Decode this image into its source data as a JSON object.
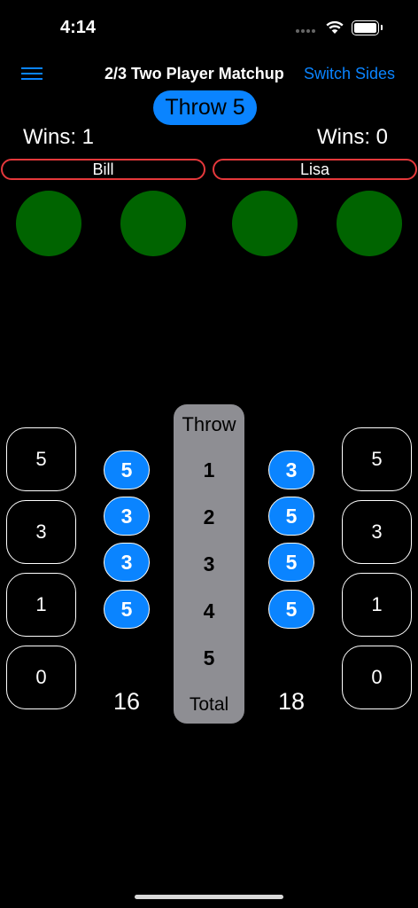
{
  "status": {
    "time": "4:14"
  },
  "nav": {
    "title": "2/3 Two Player Matchup",
    "switch_label": "Switch Sides"
  },
  "throw_label": "Throw 5",
  "players": {
    "left": {
      "name": "Bill",
      "wins": "Wins: 1",
      "total": "16",
      "throws": [
        "5",
        "3",
        "3",
        "5"
      ]
    },
    "right": {
      "name": "Lisa",
      "wins": "Wins: 0",
      "total": "18",
      "throws": [
        "3",
        "5",
        "5",
        "5"
      ]
    }
  },
  "score_options": [
    "5",
    "3",
    "1",
    "0"
  ],
  "throw_column": {
    "header": "Throw",
    "numbers": [
      "1",
      "2",
      "3",
      "4",
      "5"
    ],
    "footer": "Total"
  },
  "colors": {
    "accent": "#0a84ff",
    "indicator": "#006400",
    "name_border": "#e5383b",
    "column": "#8e8e93"
  },
  "icons": {
    "menu": "hamburger-menu-icon",
    "wifi": "wifi-icon",
    "battery": "battery-icon"
  }
}
